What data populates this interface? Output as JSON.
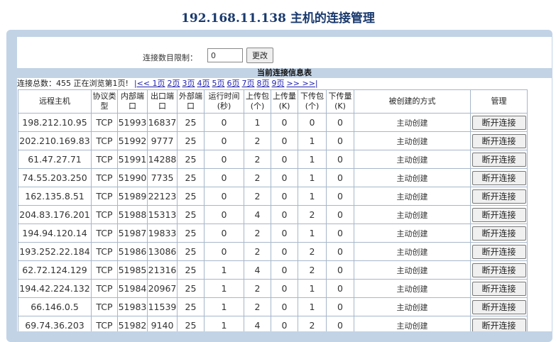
{
  "title": "192.168.11.138 主机的连接管理",
  "limit": {
    "label": "连接数目限制：",
    "value": "0",
    "button": "更改"
  },
  "table_title": "当前连接信息表",
  "summary": "连接总数：455 正在浏览第1页!",
  "pages": [
    "|<< 1页",
    "2页",
    "3页",
    "4页",
    "5页",
    "6页",
    "7页",
    "8页",
    "9页",
    ">> >>|"
  ],
  "headers": [
    "远程主机",
    "协议类型",
    "内部端口",
    "出口端口",
    "外部端口",
    "运行时间(秒)",
    "上传包(个)",
    "上传量(K)",
    "下传包(个)",
    "下传量(K)",
    "被创建的方式",
    "管理"
  ],
  "rows": [
    [
      "198.212.10.95",
      "TCP",
      "51993",
      "16837",
      "25",
      "0",
      "1",
      "0",
      "0",
      "0",
      "主动创建",
      "断开连接"
    ],
    [
      "202.210.169.83",
      "TCP",
      "51992",
      "9777",
      "25",
      "0",
      "2",
      "0",
      "1",
      "0",
      "主动创建",
      "断开连接"
    ],
    [
      "61.47.27.71",
      "TCP",
      "51991",
      "14288",
      "25",
      "0",
      "2",
      "0",
      "1",
      "0",
      "主动创建",
      "断开连接"
    ],
    [
      "74.55.203.250",
      "TCP",
      "51990",
      "7735",
      "25",
      "0",
      "2",
      "0",
      "1",
      "0",
      "主动创建",
      "断开连接"
    ],
    [
      "162.135.8.51",
      "TCP",
      "51989",
      "22123",
      "25",
      "0",
      "2",
      "0",
      "1",
      "0",
      "主动创建",
      "断开连接"
    ],
    [
      "204.83.176.201",
      "TCP",
      "51988",
      "15313",
      "25",
      "0",
      "4",
      "0",
      "2",
      "0",
      "主动创建",
      "断开连接"
    ],
    [
      "194.94.120.14",
      "TCP",
      "51987",
      "19833",
      "25",
      "0",
      "2",
      "0",
      "1",
      "0",
      "主动创建",
      "断开连接"
    ],
    [
      "193.252.22.184",
      "TCP",
      "51986",
      "13086",
      "25",
      "0",
      "2",
      "0",
      "2",
      "0",
      "主动创建",
      "断开连接"
    ],
    [
      "62.72.124.129",
      "TCP",
      "51985",
      "21316",
      "25",
      "1",
      "4",
      "0",
      "2",
      "0",
      "主动创建",
      "断开连接"
    ],
    [
      "194.42.224.132",
      "TCP",
      "51984",
      "20967",
      "25",
      "1",
      "2",
      "0",
      "1",
      "0",
      "主动创建",
      "断开连接"
    ],
    [
      "66.146.0.5",
      "TCP",
      "51983",
      "11539",
      "25",
      "1",
      "2",
      "0",
      "1",
      "0",
      "主动创建",
      "断开连接"
    ],
    [
      "69.74.36.203",
      "TCP",
      "51982",
      "9140",
      "25",
      "1",
      "4",
      "0",
      "2",
      "0",
      "主动创建",
      "断开连接"
    ]
  ]
}
